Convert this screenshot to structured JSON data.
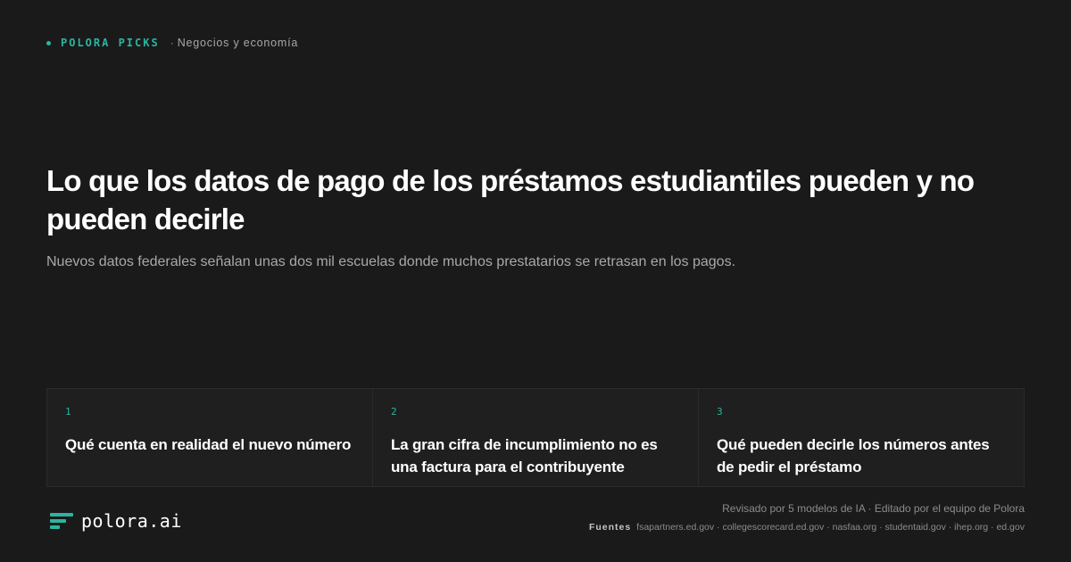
{
  "header": {
    "brand": "POLORA PICKS",
    "separator": "·",
    "category": "Negocios y economía"
  },
  "article": {
    "title": "Lo que los datos de pago de los préstamos estudiantiles pueden y no pueden decirle",
    "subtitle": "Nuevos datos federales señalan unas dos mil escuelas donde muchos prestatarios se retrasan en los pagos."
  },
  "cards": [
    {
      "num": "1",
      "title": "Qué cuenta en realidad el nuevo número"
    },
    {
      "num": "2",
      "title": "La gran cifra de incumplimiento no es una factura para el contribuyente"
    },
    {
      "num": "3",
      "title": "Qué pueden decirle los números antes de pedir el préstamo"
    }
  ],
  "footer": {
    "logo_text": "polora.ai",
    "logo_icon": "polora-bars-icon",
    "reviewed": "Revisado por 5 modelos de IA · Editado por el equipo de Polora",
    "sources_label": "Fuentes",
    "sources_list": "fsapartners.ed.gov · collegescorecard.ed.gov · nasfaa.org · studentaid.gov · ihep.org · ed.gov"
  },
  "colors": {
    "background": "#1a1a1a",
    "accent": "#2bb5a0",
    "card_bg": "#1f1f1f"
  }
}
